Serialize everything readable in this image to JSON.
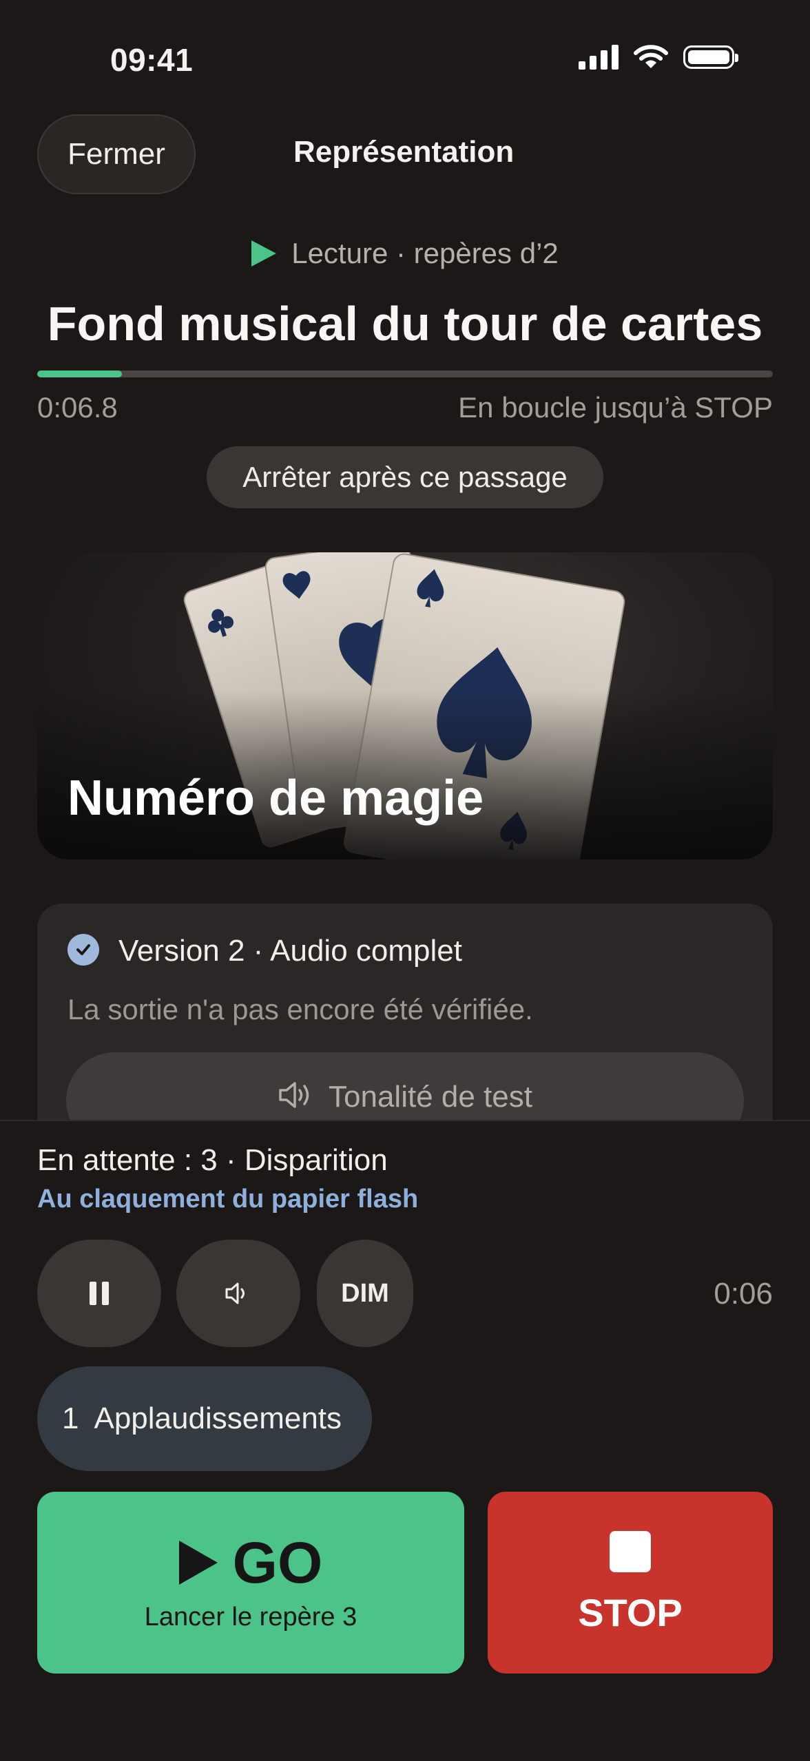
{
  "status_bar": {
    "time": "09:41"
  },
  "header": {
    "close_label": "Fermer",
    "title": "Représentation"
  },
  "now_playing": {
    "status": "Lecture · repères d’2",
    "title": "Fond musical du tour de cartes",
    "progress_fraction": 0.115,
    "elapsed": "0:06.8",
    "loop_text": "En boucle jusqu’à STOP",
    "stop_after_label": "Arrêter après ce passage"
  },
  "scene": {
    "title": "Numéro de magie"
  },
  "version_card": {
    "label": "Version 2 · Audio complet",
    "note": "La sortie n'a pas encore été vérifiée.",
    "test_tone_label": "Tonalité de test"
  },
  "queue": {
    "pending": "En attente : 3 · Disparition",
    "trigger": "Au claquement du papier flash"
  },
  "controls": {
    "dim_label": "DIM",
    "remaining": "0:06",
    "next_number": "1",
    "next_label": "Applaudissements"
  },
  "go": {
    "label": "GO",
    "sub": "Lancer le repère 3"
  },
  "stop": {
    "label": "STOP"
  },
  "colors": {
    "accent_green": "#4cc389",
    "stop_red": "#c8332b",
    "link_blue": "#8fb0dc"
  }
}
